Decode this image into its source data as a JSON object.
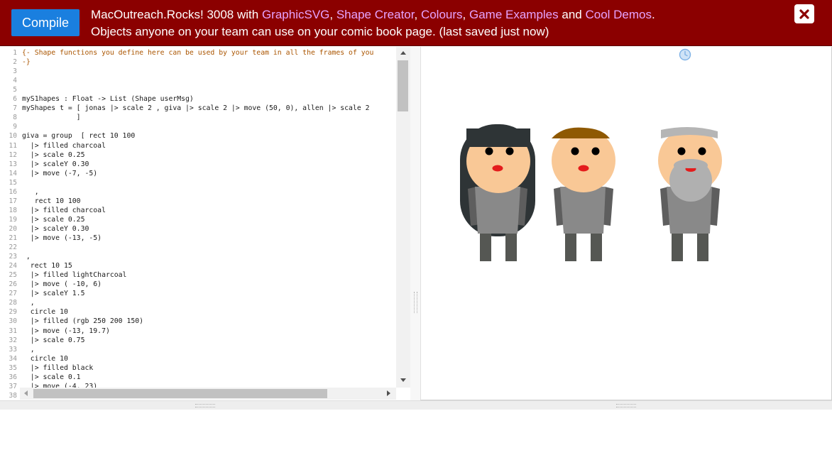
{
  "header": {
    "compile_label": "Compile",
    "line1_text": "MacOutreach.Rocks! 3008 with ",
    "links": [
      "GraphicSVG",
      "Shape Creator",
      "Colours",
      "Game Examples",
      "Cool Demos"
    ],
    "sep1": ", ",
    "sep2": ", ",
    "sep3": ", ",
    "and_text": " and ",
    "end_text": ".",
    "line2_text": "Objects anyone on your team can use on your comic book page. (last saved just now)",
    "close_icon": "close-x-icon"
  },
  "editor": {
    "line_numbers": [
      "1",
      "2",
      "3",
      "4",
      "5",
      "6",
      "7",
      "8",
      "9",
      "10",
      "11",
      "12",
      "13",
      "14",
      "15",
      "16",
      "17",
      "18",
      "19",
      "20",
      "21",
      "22",
      "23",
      "24",
      "25",
      "26",
      "27",
      "28",
      "29",
      "30",
      "31",
      "32",
      "33",
      "34",
      "35",
      "36",
      "37",
      "38"
    ],
    "lines": [
      "{- Shape functions you define here can be used by your team in all the frames of you",
      "-}",
      "",
      "",
      "",
      "myS1hapes : Float -> List (Shape userMsg)",
      "myShapes t = [ jonas |> scale 2 , giva |> scale 2 |> move (50, 0), allen |> scale 2",
      "             ]",
      "",
      "giva = group  [ rect 10 100",
      "  |> filled charcoal",
      "  |> scale 0.25",
      "  |> scaleY 0.30",
      "  |> move (-7, -5)",
      "",
      "   ,",
      "   rect 10 100",
      "  |> filled charcoal",
      "  |> scale 0.25",
      "  |> scaleY 0.30",
      "  |> move (-13, -5)",
      "",
      " ,",
      "  rect 10 15",
      "  |> filled lightCharcoal",
      "  |> move ( -10, 6)",
      "  |> scaleY 1.5",
      "  ,",
      "  circle 10",
      "  |> filled (rgb 250 200 150)",
      "  |> move (-13, 19.7)",
      "  |> scale 0.75",
      "  ,",
      "  circle 10",
      "  |> filled black",
      "  |> scale 0.1",
      "  |> move (-4, 23)",
      "  ,"
    ]
  },
  "canvas": {
    "clock_icon": "clock-icon",
    "characters": [
      "long-dark-hair-character",
      "brown-hair-character",
      "grey-bearded-character"
    ],
    "colors": {
      "skin": "#f9c896",
      "shirt": "#898989",
      "shirt_dark": "#5e5e5e",
      "legs": "#555753",
      "hair_dark": "#2e3436",
      "hair_brown": "#8f5902",
      "hair_grey": "#b5b5b5",
      "beard": "#b0b0b0",
      "mouth": "#e41c1c",
      "eyes": "#000000"
    }
  },
  "theme": {
    "header_bg": "#8b0000",
    "compile_bg": "#1a7fdf",
    "link_color": "#e6a3ff"
  }
}
